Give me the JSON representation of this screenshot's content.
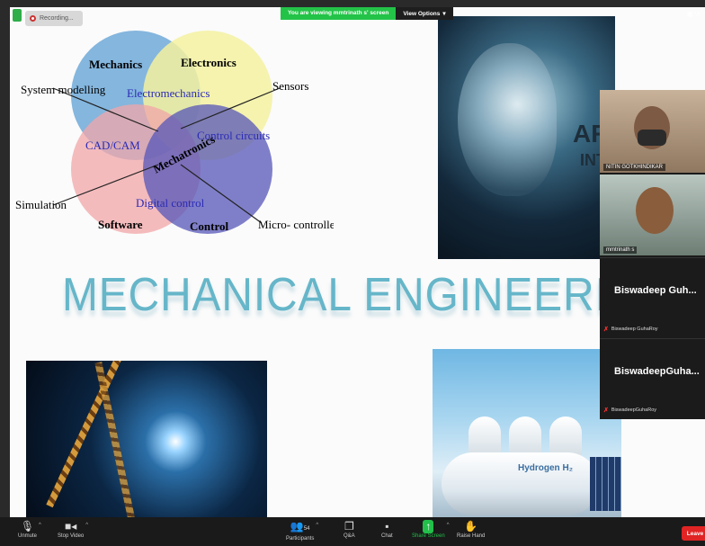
{
  "recording": {
    "label": "Recording..."
  },
  "share_banner": {
    "message": "You are viewing mmtrinath s' screen",
    "options_label": "View Options",
    "options_caret": "▾"
  },
  "view_corner": {
    "label": "Vi"
  },
  "slide": {
    "venn": {
      "circles": [
        "Mechanics",
        "Electronics",
        "Software",
        "Control"
      ],
      "overlaps": [
        "Electromechanics",
        "CAD/CAM",
        "Control circuits",
        "Digital control",
        "Mechatronics"
      ],
      "callouts": [
        "System modelling",
        "Sensors",
        "Simulation",
        "Micro- controllers"
      ]
    },
    "title": "MECHANICAL ENGINEERIN",
    "ai_image_text": [
      "ART",
      "INT"
    ],
    "hydrogen_label": "Hydrogen H₂"
  },
  "participants": [
    {
      "name": "NITIN GOTKHINDIKAR",
      "type": "video"
    },
    {
      "name": "mmtrinath s",
      "type": "video"
    },
    {
      "display_name": "Biswadeep  Guh...",
      "name": "Biswadeep GuhaRoy",
      "type": "text",
      "muted": true
    },
    {
      "display_name": "BiswadeepGuha...",
      "name": "BiswadeepGuhaRoy",
      "type": "text",
      "muted": true
    }
  ],
  "toolbar": {
    "unmute": "Unmute",
    "stop_video": "Stop Video",
    "participants": "Participants",
    "participants_count": "54",
    "qa": "Q&A",
    "chat": "Chat",
    "share_screen": "Share Screen",
    "raise_hand": "Raise Hand",
    "leave": "Leave"
  },
  "colors": {
    "share_green": "#23c348",
    "leave_red": "#e02424",
    "title_teal": "#66b6c9"
  }
}
